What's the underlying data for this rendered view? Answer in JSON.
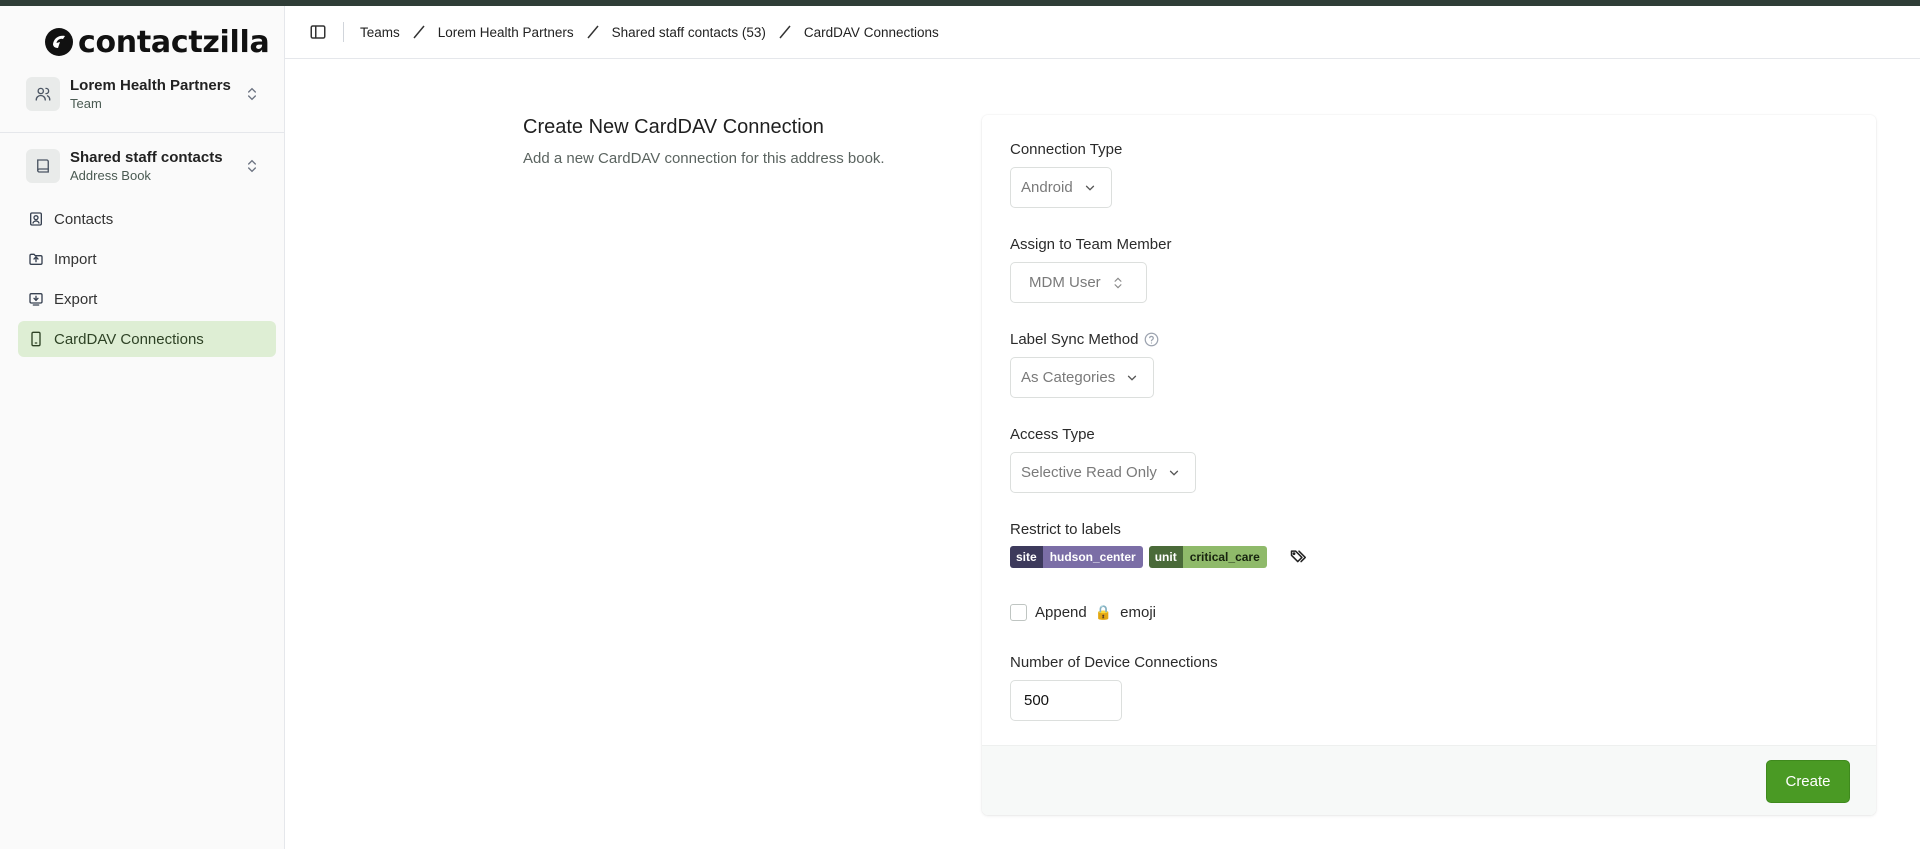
{
  "app": {
    "brand": "contactzilla",
    "accent": "#2f3d37",
    "primary_button_color": "#4a9a24",
    "active_nav_color": "#deeed4"
  },
  "sidebar": {
    "team_switcher": {
      "title": "Lorem Health Partners",
      "subtitle": "Team",
      "icon": "users-icon"
    },
    "book_switcher": {
      "title": "Shared staff contacts",
      "subtitle": "Address Book",
      "icon": "book-icon"
    },
    "items": [
      {
        "label": "Contacts",
        "icon": "contact-card-icon",
        "active": false
      },
      {
        "label": "Import",
        "icon": "import-icon",
        "active": false
      },
      {
        "label": "Export",
        "icon": "export-icon",
        "active": false
      },
      {
        "label": "CardDAV Connections",
        "icon": "smartphone-icon",
        "active": true
      }
    ]
  },
  "header": {
    "breadcrumbs": [
      "Teams",
      "Lorem Health Partners",
      "Shared staff contacts (53)",
      "CardDAV Connections"
    ]
  },
  "intro": {
    "title": "Create New CardDAV Connection",
    "subtitle": "Add a new CardDAV connection for this address book."
  },
  "form": {
    "connection_type": {
      "label": "Connection Type",
      "value": "Android"
    },
    "team_member": {
      "label": "Assign to Team Member",
      "value": "MDM User"
    },
    "label_sync": {
      "label": "Label Sync Method",
      "value": "As Categories"
    },
    "access_type": {
      "label": "Access Type",
      "value": "Selective Read Only"
    },
    "restrict_labels": {
      "label": "Restrict to labels",
      "tags": [
        {
          "key": "site",
          "value": "hudson_center"
        },
        {
          "key": "unit",
          "value": "critical_care"
        }
      ]
    },
    "append_emoji": {
      "label_prefix": "Append",
      "emoji": "🔒",
      "label_suffix": "emoji",
      "checked": false
    },
    "device_connections": {
      "label": "Number of Device Connections",
      "value": "500"
    },
    "submit_label": "Create"
  }
}
